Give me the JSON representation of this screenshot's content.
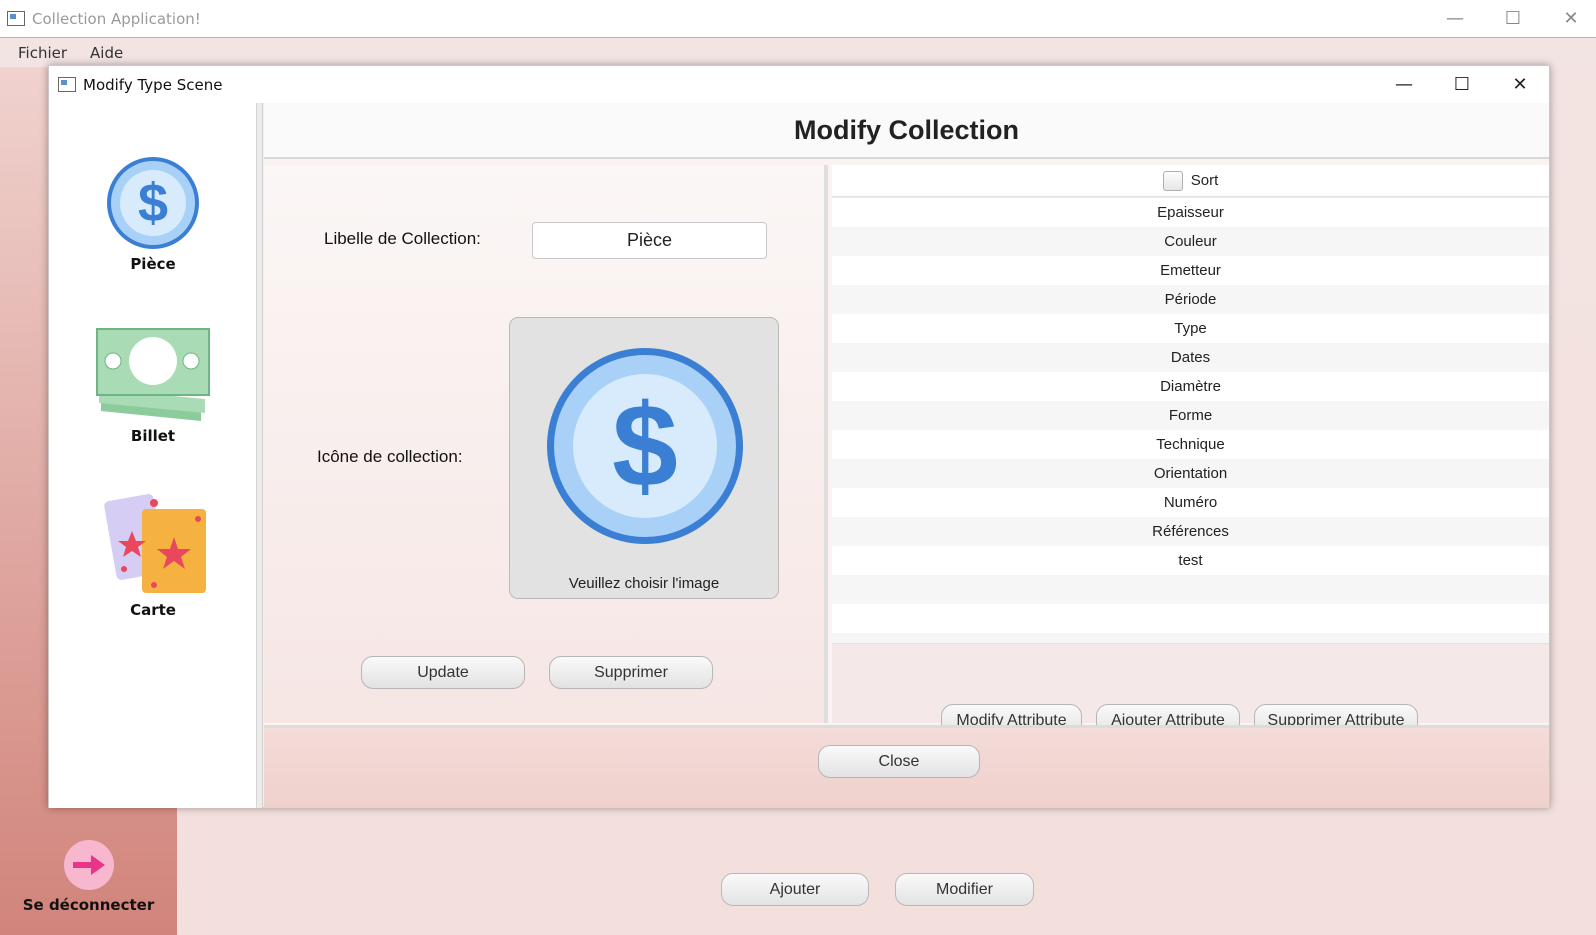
{
  "main_window": {
    "title": "Collection Application!",
    "menu": [
      "Fichier",
      "Aide"
    ],
    "logout_label": "Se déconnecter",
    "buttons": {
      "add": "Ajouter",
      "modify": "Modifier"
    }
  },
  "dialog": {
    "title": "Modify Type Scene",
    "heading": "Modify Collection",
    "sidebar": [
      {
        "label": "Pièce",
        "icon": "coin-dollar-icon"
      },
      {
        "label": "Billet",
        "icon": "banknote-icon"
      },
      {
        "label": "Carte",
        "icon": "cards-icon"
      }
    ],
    "form": {
      "name_label": "Libelle de Collection:",
      "name_value": "Pièce",
      "icon_label": "Icône de collection:",
      "image_caption": "Veuillez choisir l'image",
      "update_button": "Update",
      "delete_button": "Supprimer"
    },
    "attributes": {
      "sort_label": "Sort",
      "sort_checked": false,
      "items": [
        "Epaisseur",
        "Couleur",
        "Emetteur",
        "Période",
        "Type",
        "Dates",
        "Diamètre",
        "Forme",
        "Technique",
        "Orientation",
        "Numéro",
        "Références",
        "test"
      ],
      "modify_button": "Modify Attribute",
      "add_button": "Ajouter Attribute",
      "delete_button": "Supprimer Attribute"
    },
    "close_button": "Close"
  },
  "colors": {
    "accent_pink": "#f7b8cf",
    "coin_blue": "#3b7fd4",
    "coin_fill": "#cfe6fb",
    "banknote_green": "#a9dbb5"
  }
}
